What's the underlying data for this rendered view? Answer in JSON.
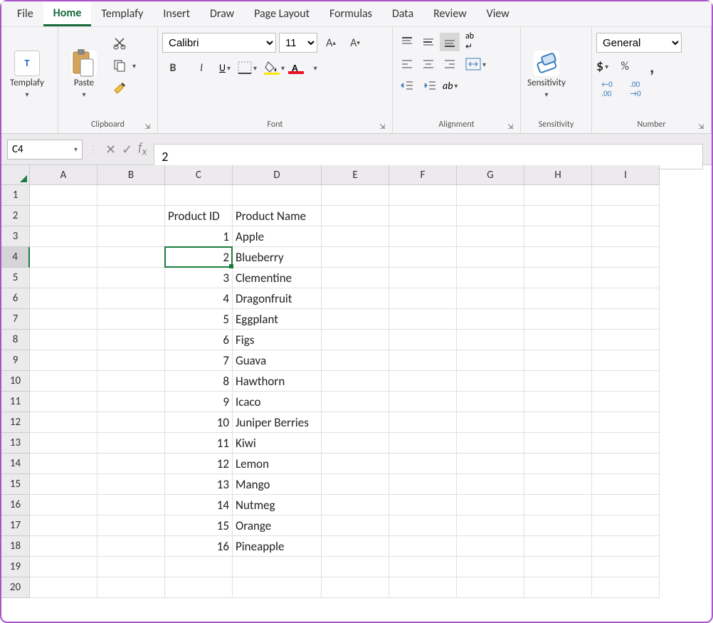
{
  "tabs": [
    "File",
    "Home",
    "Templafy",
    "Insert",
    "Draw",
    "Page Layout",
    "Formulas",
    "Data",
    "Review",
    "View"
  ],
  "activeTab": "Home",
  "ribbon": {
    "templafy_label": "Templafy",
    "clipboard": {
      "paste": "Paste",
      "label": "Clipboard"
    },
    "font": {
      "name": "Calibri",
      "size": "11",
      "label": "Font",
      "bold": "B",
      "italic": "I",
      "underline": "U"
    },
    "alignment": {
      "label": "Alignment"
    },
    "sensitivity": {
      "label": "Sensitivity",
      "btn": "Sensitivity"
    },
    "number": {
      "label": "Number",
      "format": "General",
      "currency": "$",
      "percent": "%",
      "comma": ",",
      "dec_inc": ".00",
      "dec_dec": ".00"
    }
  },
  "formulaBar": {
    "cellRef": "C4",
    "value": "2"
  },
  "columns": [
    "A",
    "B",
    "C",
    "D",
    "E",
    "F",
    "G",
    "H",
    "I"
  ],
  "selectedCell": {
    "row": 4,
    "col": "C"
  },
  "rows": [
    {
      "n": 1,
      "C": "",
      "D": ""
    },
    {
      "n": 2,
      "C": "Product ID",
      "D": "Product Name"
    },
    {
      "n": 3,
      "C": "1",
      "D": "Apple"
    },
    {
      "n": 4,
      "C": "2",
      "D": "Blueberry"
    },
    {
      "n": 5,
      "C": "3",
      "D": "Clementine"
    },
    {
      "n": 6,
      "C": "4",
      "D": "Dragonfruit"
    },
    {
      "n": 7,
      "C": "5",
      "D": "Eggplant"
    },
    {
      "n": 8,
      "C": "6",
      "D": "Figs"
    },
    {
      "n": 9,
      "C": "7",
      "D": "Guava"
    },
    {
      "n": 10,
      "C": "8",
      "D": "Hawthorn"
    },
    {
      "n": 11,
      "C": "9",
      "D": "Icaco"
    },
    {
      "n": 12,
      "C": "10",
      "D": "Juniper Berries"
    },
    {
      "n": 13,
      "C": "11",
      "D": "Kiwi"
    },
    {
      "n": 14,
      "C": "12",
      "D": "Lemon"
    },
    {
      "n": 15,
      "C": "13",
      "D": "Mango"
    },
    {
      "n": 16,
      "C": "14",
      "D": "Nutmeg"
    },
    {
      "n": 17,
      "C": "15",
      "D": "Orange"
    },
    {
      "n": 18,
      "C": "16",
      "D": "Pineapple"
    },
    {
      "n": 19,
      "C": "",
      "D": ""
    },
    {
      "n": 20,
      "C": "",
      "D": ""
    }
  ]
}
